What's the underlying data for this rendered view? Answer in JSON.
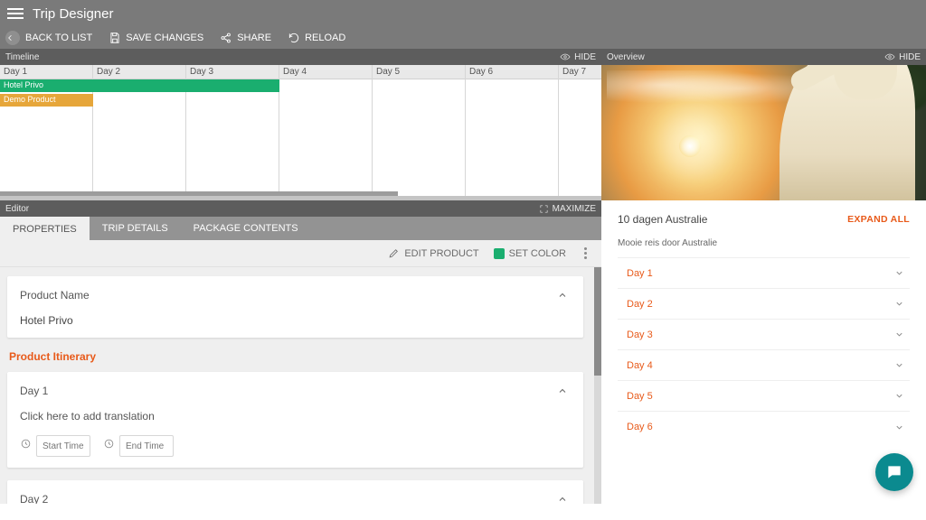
{
  "app": {
    "title": "Trip Designer"
  },
  "actions": {
    "back": "BACK TO LIST",
    "save": "SAVE CHANGES",
    "share": "SHARE",
    "reload": "RELOAD"
  },
  "timeline": {
    "label": "Timeline",
    "hide": "HIDE",
    "days": [
      "Day 1",
      "Day 2",
      "Day 3",
      "Day 4",
      "Day 5",
      "Day 6",
      "Day 7"
    ],
    "items": [
      {
        "label": "Hotel Privo",
        "color": "green",
        "startDay": 0,
        "span": 3
      },
      {
        "label": "Hotel Privo",
        "color": "green",
        "startDay": 1,
        "span": 1
      },
      {
        "label": "Hotel Privo",
        "color": "green",
        "startDay": 2,
        "span": 1
      },
      {
        "label": "Demo Product",
        "color": "orange",
        "startDay": 0,
        "span": 1
      }
    ]
  },
  "overview": {
    "label": "Overview",
    "hide": "HIDE",
    "title": "10 dagen Australie",
    "expand": "EXPAND ALL",
    "subtitle": "Mooie reis door Australie",
    "days": [
      "Day 1",
      "Day 2",
      "Day 3",
      "Day 4",
      "Day 5",
      "Day 6"
    ]
  },
  "editor": {
    "label": "Editor",
    "maximize": "MAXIMIZE",
    "tabs": {
      "properties": "PROPERTIES",
      "trip": "TRIP DETAILS",
      "package": "PACKAGE CONTENTS"
    },
    "toolbar": {
      "edit": "EDIT PRODUCT",
      "setcolor": "SET COLOR"
    },
    "productName": {
      "label": "Product Name",
      "value": "Hotel Privo"
    },
    "itineraryTitle": "Product Itinerary",
    "day1": {
      "label": "Day 1",
      "placeholder": "Click here to add translation",
      "startPlaceholder": "Start Time",
      "endPlaceholder": "End Time"
    },
    "day2": {
      "label": "Day 2"
    }
  }
}
